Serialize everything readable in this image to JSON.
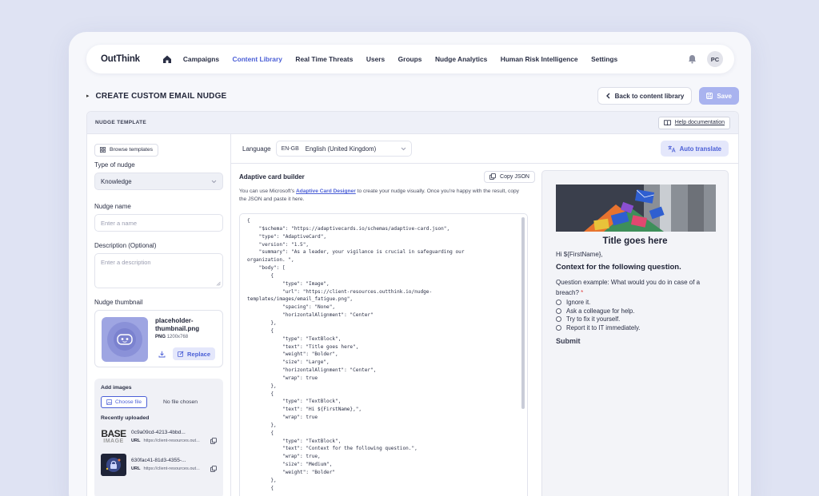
{
  "nav": {
    "logo": "OutThink",
    "links": [
      "Campaigns",
      "Content Library",
      "Real Time Threats",
      "Users",
      "Groups",
      "Nudge Analytics",
      "Human Risk Intelligence",
      "Settings"
    ],
    "active": "Content Library",
    "avatar_initials": "PC"
  },
  "header": {
    "title": "CREATE CUSTOM EMAIL NUDGE",
    "back_label": "Back to content library",
    "save_label": "Save"
  },
  "panel": {
    "title": "NUDGE TEMPLATE",
    "help_label": "Help documentation"
  },
  "left": {
    "browse_label": "Browse templates",
    "type_label": "Type of nudge",
    "type_value": "Knowledge",
    "name_label": "Nudge name",
    "name_placeholder": "Enter a name",
    "desc_label": "Description (Optional)",
    "desc_placeholder": "Enter a description",
    "thumb_label": "Nudge thumbnail",
    "thumb_name": "placeholder-thumbnail.png",
    "thumb_format": "PNG",
    "thumb_size": "1200x768",
    "replace_label": "Replace",
    "add_images_label": "Add images",
    "choose_file_label": "Choose file",
    "no_file_label": "No file chosen",
    "recent_label": "Recently uploaded",
    "recent": [
      {
        "id": "0c9a09cd-4213-4bbd...",
        "url_label": "URL",
        "url": "https://client-resources.out...",
        "thumb_top": "BASE",
        "thumb_bottom": "IMAGE"
      },
      {
        "id": "630fac41-81d3-4355-...",
        "url_label": "URL",
        "url": "https://client-resources.out..."
      }
    ]
  },
  "language": {
    "label": "Language",
    "code": "EN-GB",
    "value": "English (United Kingdom)",
    "auto_translate_label": "Auto translate"
  },
  "builder": {
    "title": "Adaptive card builder",
    "copy_label": "Copy JSON",
    "desc_before": "You can use Microsoft's ",
    "desc_link": "Adaptive Card Designer",
    "desc_after": " to create your nudge visually. Once you're happy with the result, copy the JSON and paste it here.",
    "code": "{\n    \"$schema\": \"https://adaptivecards.io/schemas/adaptive-card.json\",\n    \"type\": \"AdaptiveCard\",\n    \"version\": \"1.5\",\n    \"summary\": \"As a leader, your vigilance is crucial in safeguarding our\norganization. \",\n    \"body\": [\n        {\n            \"type\": \"Image\",\n            \"url\": \"https://client-resources.outthink.io/nudge-\ntemplates/images/email_fatigue.png\",\n            \"spacing\": \"None\",\n            \"horizontalAlignment\": \"Center\"\n        },\n        {\n            \"type\": \"TextBlock\",\n            \"text\": \"Title goes here\",\n            \"weight\": \"Bolder\",\n            \"size\": \"Large\",\n            \"horizontalAlignment\": \"Center\",\n            \"wrap\": true\n        },\n        {\n            \"type\": \"TextBlock\",\n            \"text\": \"Hi ${FirstName},\",\n            \"wrap\": true\n        },\n        {\n            \"type\": \"TextBlock\",\n            \"text\": \"Context for the following question.\",\n            \"wrap\": true,\n            \"size\": \"Medium\",\n            \"weight\": \"Bolder\"\n        },\n        {"
  },
  "preview": {
    "title": "Title goes here",
    "greeting": "Hi ${FirstName},",
    "context": "Context for the following question.",
    "question": "Question example: What would you do in case of a breach?",
    "required_mark": "*",
    "options": [
      "Ignore it.",
      "Ask a colleague for help.",
      "Try to fix it yourself.",
      "Report it to IT immediately."
    ],
    "submit_label": "Submit"
  },
  "colors": {
    "accent": "#4b5fd6",
    "save_disabled": "#a9b3ef",
    "required": "#e04848"
  }
}
